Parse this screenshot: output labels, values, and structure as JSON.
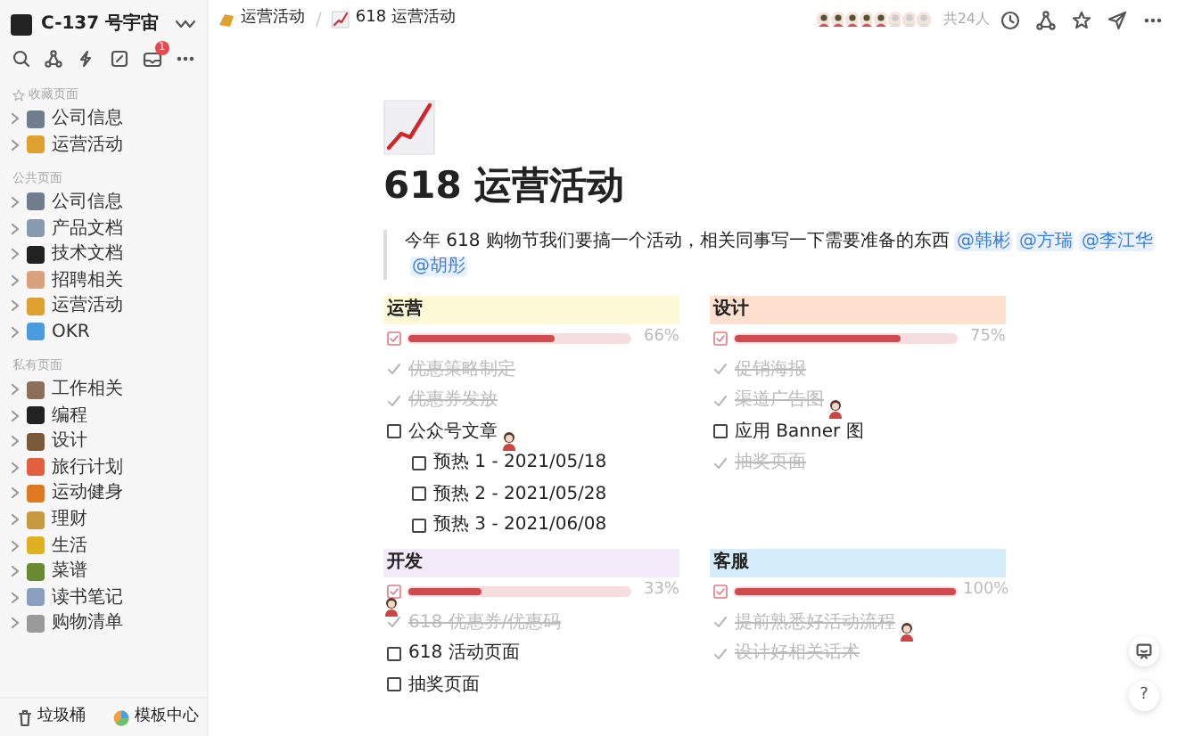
{
  "sidebar": {
    "workspace": "C-137 号宇宙",
    "badge": "1",
    "sections": [
      {
        "label": "收藏页面",
        "starred": true,
        "items": [
          {
            "label": "公司信息",
            "color": "#6f7d8c"
          },
          {
            "label": "运营活动",
            "color": "#e0a030"
          }
        ]
      },
      {
        "label": "公共页面",
        "starred": false,
        "items": [
          {
            "label": "公司信息",
            "color": "#6f7d8c"
          },
          {
            "label": "产品文档",
            "color": "#8a9bb0"
          },
          {
            "label": "技术文档",
            "color": "#222222"
          },
          {
            "label": "招聘相关",
            "color": "#d9a27a"
          },
          {
            "label": "运营活动",
            "color": "#e0a030"
          },
          {
            "label": "OKR",
            "color": "#4a9be0"
          }
        ]
      },
      {
        "label": "私有页面",
        "starred": false,
        "items": [
          {
            "label": "工作相关",
            "color": "#8c6e5a"
          },
          {
            "label": "编程",
            "color": "#222222"
          },
          {
            "label": "设计",
            "color": "#7a5a3a"
          },
          {
            "label": "旅行计划",
            "color": "#e06040"
          },
          {
            "label": "运动健身",
            "color": "#e07a20"
          },
          {
            "label": "理财",
            "color": "#c89a40"
          },
          {
            "label": "生活",
            "color": "#e0b020"
          },
          {
            "label": "菜谱",
            "color": "#6a8a30"
          },
          {
            "label": "读书笔记",
            "color": "#8aa0c0"
          },
          {
            "label": "购物清单",
            "color": "#9a9a9a"
          }
        ]
      }
    ],
    "footer": [
      {
        "label": "垃圾桶",
        "kind": "trash"
      },
      {
        "label": "模板中心",
        "kind": "template"
      }
    ]
  },
  "breadcrumb": [
    "运营活动",
    "618 运营活动"
  ],
  "breadcrumb_separator": "/",
  "members": "共24人",
  "page": {
    "title": "618 运营活动",
    "intro": "今年 618 购物节我们要搞一个活动，相关同事写一下需要准备的东西",
    "mentions": [
      "@韩彬",
      "@方瑞",
      "@李江华",
      "@胡彤"
    ],
    "columns": [
      {
        "title": "运营",
        "color": "#fdf8d6",
        "cursor": false,
        "level": 0.66,
        "percent": "66%",
        "tasks": [
          {
            "text": "优惠策略制定",
            "done": true,
            "cursor": false
          },
          {
            "text": "优惠券发放",
            "done": true,
            "cursor": false
          },
          {
            "text": "公众号文章",
            "done": false,
            "cursor": true,
            "children": [
              {
                "text": "预热 1 - 2021/05/18",
                "done": false,
                "cursor": false
              },
              {
                "text": "预热 2 - 2021/05/28",
                "done": false,
                "cursor": false
              },
              {
                "text": "预热 3 - 2021/06/08",
                "done": false,
                "cursor": false
              }
            ]
          }
        ]
      },
      {
        "title": "设计",
        "color": "#fde0cf",
        "cursor": false,
        "level": 0.75,
        "percent": "75%",
        "tasks": [
          {
            "text": "促销海报",
            "done": true,
            "cursor": false
          },
          {
            "text": "渠道广告图",
            "done": true,
            "cursor": true
          },
          {
            "text": "应用 Banner 图",
            "done": false,
            "cursor": false
          },
          {
            "text": "抽奖页面",
            "done": true,
            "cursor": false
          }
        ]
      },
      {
        "title": "开发",
        "color": "#f4ebfa",
        "cursor": true,
        "level": 0.33,
        "percent": "33%",
        "tasks": [
          {
            "text": "618 优惠券/优惠码",
            "done": true,
            "cursor": false
          },
          {
            "text": "618 活动页面",
            "done": false,
            "cursor": false
          },
          {
            "text": "抽奖页面",
            "done": false,
            "cursor": false
          }
        ]
      },
      {
        "title": "客服",
        "color": "#d5edfb",
        "cursor": false,
        "level": 1,
        "percent": "100%",
        "tasks": [
          {
            "text": "提前熟悉好活动流程",
            "done": true,
            "cursor": true
          },
          {
            "text": "设计好相关话术",
            "done": true,
            "cursor": false
          }
        ]
      }
    ]
  },
  "help": "?"
}
